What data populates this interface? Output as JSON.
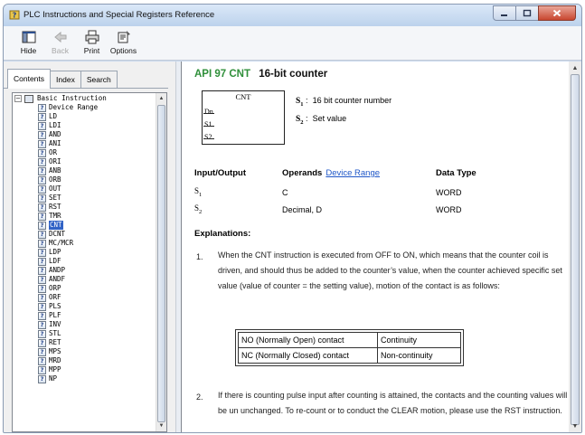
{
  "window": {
    "title": "PLC Instructions and Special Registers Reference",
    "controls": [
      "minimize",
      "maximize",
      "close"
    ]
  },
  "toolbar": {
    "buttons": [
      {
        "label": "Hide",
        "icon": "hide-icon",
        "enabled": true
      },
      {
        "label": "Back",
        "icon": "back-icon",
        "enabled": false
      },
      {
        "label": "Print",
        "icon": "print-icon",
        "enabled": true
      },
      {
        "label": "Options",
        "icon": "options-icon",
        "enabled": true
      }
    ]
  },
  "nav": {
    "tabs": [
      "Contents",
      "Index",
      "Search"
    ],
    "active_tab": "Contents",
    "root": "Basic Instruction",
    "items": [
      "Device Range",
      "LD",
      "LDI",
      "AND",
      "ANI",
      "OR",
      "ORI",
      "ANB",
      "ORB",
      "OUT",
      "SET",
      "RST",
      "TMR",
      "CNT",
      "DCNT",
      "MC/MCR",
      "LDP",
      "LDF",
      "ANDP",
      "ANDF",
      "ORP",
      "ORF",
      "PLS",
      "PLF",
      "INV",
      "STL",
      "RET",
      "MPS",
      "MRD",
      "MPP",
      "NP"
    ],
    "selected": "CNT"
  },
  "doc": {
    "api": "API 97",
    "mnemonic": "CNT",
    "title": "16-bit counter",
    "symbol": {
      "name": "CNT",
      "pins": [
        "Dn",
        "S1",
        "S2"
      ]
    },
    "operand_defs": [
      {
        "sym": "S",
        "sub": "1",
        "desc": "16 bit counter number"
      },
      {
        "sym": "S",
        "sub": "2",
        "desc": "Set value"
      }
    ],
    "io_headers": {
      "io": "Input/Output",
      "operands": "Operands",
      "device_range_link": "Device Range",
      "data_type": "Data Type"
    },
    "io_rows": [
      {
        "sym": "S",
        "sub": "1",
        "operands": "C",
        "type": "WORD"
      },
      {
        "sym": "S",
        "sub": "2",
        "operands": "Decimal, D",
        "type": "WORD"
      }
    ],
    "explanations_label": "Explanations:",
    "para1_num": "1.",
    "para1": "When the CNT instruction is executed from OFF to ON, which means that the counter coil is driven, and should thus be added to the counter’s value, when the counter achieved specific set value (value of counter = the setting value), motion of the contact is as follows:",
    "contact_table": [
      [
        "NO (Normally Open) contact",
        "Continuity"
      ],
      [
        "NC (Normally Closed) contact",
        "Non-continuity"
      ]
    ],
    "para2_num": "2.",
    "para2": "If there is counting pulse input after counting is attained, the contacts and the counting values will be un unchanged. To re-count or to conduct the CLEAR motion, please use the RST instruction."
  },
  "colors": {
    "api_green": "#2f8f3a",
    "link_blue": "#1f57c8",
    "selection": "#3163c6"
  }
}
